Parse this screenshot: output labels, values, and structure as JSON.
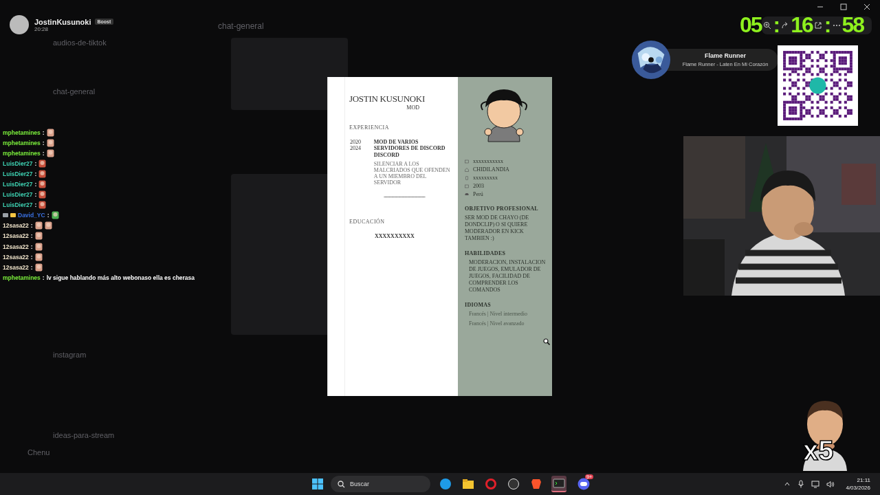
{
  "background_channels": {
    "header": "chat-general",
    "items": [
      "audios-de-tiktok",
      "chat-general",
      "instagram",
      "ideas-para-stream"
    ],
    "footer": "Chenu"
  },
  "chat_overlay": {
    "streamer": {
      "name": "JostinKusunoki",
      "badge": "Boost",
      "time": "20:28"
    },
    "messages": [
      {
        "user": "mphetamines",
        "color": "#7cf03c",
        "separator": ":",
        "emotes": [
          {
            "kind": "hand"
          }
        ]
      },
      {
        "user": "mphetamines",
        "color": "#7cf03c",
        "separator": ":",
        "emotes": [
          {
            "kind": "hand"
          }
        ]
      },
      {
        "user": "mphetamines",
        "color": "#7cf03c",
        "separator": ":",
        "emotes": [
          {
            "kind": "hand"
          }
        ]
      },
      {
        "user": "LuisDier27",
        "color": "#3fd4b4",
        "separator": ":",
        "emotes": [
          {
            "kind": "cat"
          }
        ]
      },
      {
        "user": "LuisDier27",
        "color": "#3fd4b4",
        "separator": ":",
        "emotes": [
          {
            "kind": "cat"
          }
        ]
      },
      {
        "user": "LuisDier27",
        "color": "#3fd4b4",
        "separator": ":",
        "emotes": [
          {
            "kind": "cat"
          }
        ]
      },
      {
        "user": "LuisDier27",
        "color": "#3fd4b4",
        "separator": ":",
        "emotes": [
          {
            "kind": "cat"
          }
        ]
      },
      {
        "user": "LuisDier27",
        "color": "#3fd4b4",
        "separator": ":",
        "emotes": [
          {
            "kind": "cat"
          }
        ]
      },
      {
        "user": "David_YC",
        "color": "#3a70e0",
        "separator": ":",
        "badges": [
          {
            "kind": "sword"
          },
          {
            "kind": "crown"
          }
        ],
        "emotes": [
          {
            "kind": "frog"
          }
        ]
      },
      {
        "user": "12sasa22",
        "color": "#f2e6cc",
        "separator": ":",
        "emotes": [
          {
            "kind": "hand"
          },
          {
            "kind": "hand"
          }
        ]
      },
      {
        "user": "12sasa22",
        "color": "#f2e6cc",
        "separator": ":",
        "emotes": [
          {
            "kind": "hand"
          }
        ]
      },
      {
        "user": "12sasa22",
        "color": "#f2e6cc",
        "separator": ":",
        "emotes": [
          {
            "kind": "hand"
          }
        ]
      },
      {
        "user": "12sasa22",
        "color": "#f2e6cc",
        "separator": ":",
        "emotes": [
          {
            "kind": "hand"
          }
        ]
      },
      {
        "user": "12sasa22",
        "color": "#f2e6cc",
        "separator": ":",
        "emotes": [
          {
            "kind": "hand"
          }
        ]
      },
      {
        "user": "mphetamines",
        "color": "#7cf03c",
        "separator": ":",
        "text": "lv sigue hablando más alto webonaso ella es cherasa"
      }
    ]
  },
  "resume": {
    "name": "JOSTIN KUSUNOKI",
    "role": "MOD",
    "experience": {
      "title": "EXPERIENCIA",
      "entries": [
        {
          "years": [
            "2020",
            "2024"
          ],
          "position": "MOD DE VARIOS SERVIDORES DE DISCORD",
          "company": "DISCORD",
          "description": "SILENCIAR A LOS MALCRIADOS QUE OFENDEN A UN MIEMBRO DEL SERVIDOR"
        }
      ],
      "separator": "------------------------------------"
    },
    "education": {
      "title": "EDUCACIÓN",
      "entries": [
        "XXXXXXXXXX"
      ]
    },
    "contact": [
      {
        "kind": "mail",
        "text": "xxxxxxxxxxx"
      },
      {
        "kind": "home",
        "text": "CHIDILANDIA"
      },
      {
        "kind": "phone",
        "text": "xxxxxxxxx"
      },
      {
        "kind": "calendar",
        "text": "2003"
      },
      {
        "kind": "car",
        "text": "Perú"
      }
    ],
    "objective": {
      "title": "OBJETIVO PROFESIONAL",
      "text": "SER MOD DE CHAYO (DE DONDCLIP) O SI QUIERE MODERADOR EN KICK TAMBIEN :)"
    },
    "skills": {
      "title": "HABILIDADES",
      "items": [
        "MODERACION, INSTALACION DE JUEGOS, EMULADOR DE JUEGOS, FACILIDAD DE COMPRENDER LOS COMANDOS"
      ]
    },
    "languages": {
      "title": "IDIOMAS",
      "items": [
        "Francés | Nivel intermedio",
        "Francés | Nivel avanzado"
      ]
    }
  },
  "timer": {
    "hours": "05",
    "minutes": "16",
    "seconds": "58",
    "separator": ":"
  },
  "now_playing": {
    "title": "Flame Runner",
    "subtitle": "Flame Runner - Laten En Mi Corazón"
  },
  "emote_overlay": {
    "multiplier": "x5"
  },
  "taskbar": {
    "search": {
      "placeholder": "Buscar"
    },
    "apps": [
      {
        "kind": "edge",
        "selected": false
      },
      {
        "kind": "folder",
        "selected": false
      },
      {
        "kind": "opera",
        "selected": false
      },
      {
        "kind": "obs",
        "selected": false
      },
      {
        "kind": "brave",
        "selected": false
      },
      {
        "kind": "terminal",
        "selected": true
      },
      {
        "kind": "discord",
        "selected": false,
        "badge": "9+"
      }
    ],
    "time": "21:11",
    "date": "4/03/2026"
  }
}
